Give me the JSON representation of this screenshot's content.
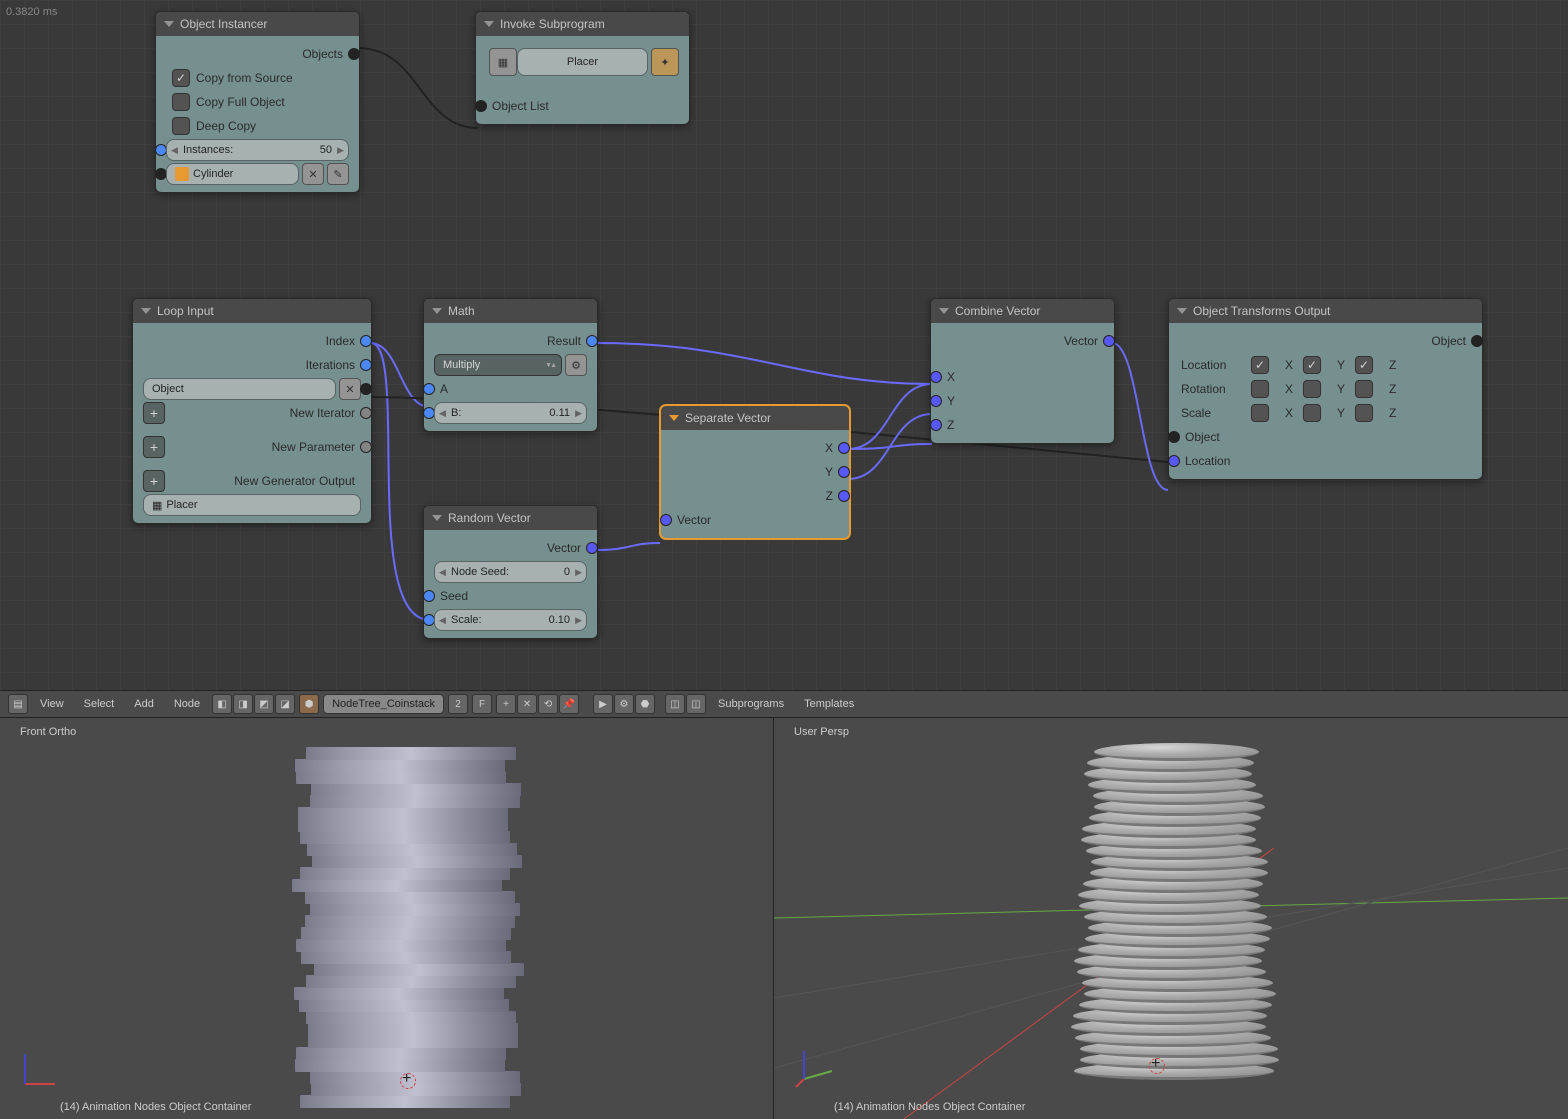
{
  "timing": "0.3820 ms",
  "nodes": {
    "instancer": {
      "title": "Object Instancer",
      "out_objects": "Objects",
      "copy_source": "Copy from Source",
      "copy_full": "Copy Full Object",
      "deep_copy": "Deep Copy",
      "instances_label": "Instances:",
      "instances_value": "50",
      "object_value": "Cylinder"
    },
    "invoke": {
      "title": "Invoke Subprogram",
      "program": "Placer",
      "in_list": "Object List"
    },
    "loop": {
      "title": "Loop Input",
      "index": "Index",
      "iterations": "Iterations",
      "object": "Object",
      "new_iter": "New Iterator",
      "new_param": "New Parameter",
      "new_gen": "New Generator Output",
      "name": "Placer"
    },
    "math": {
      "title": "Math",
      "result": "Result",
      "op": "Multiply",
      "a": "A",
      "b_label": "B:",
      "b_value": "0.11"
    },
    "randvec": {
      "title": "Random Vector",
      "vector": "Vector",
      "seed_label": "Node Seed:",
      "seed_value": "0",
      "seed": "Seed",
      "scale_label": "Scale:",
      "scale_value": "0.10"
    },
    "sepvec": {
      "title": "Separate Vector",
      "x": "X",
      "y": "Y",
      "z": "Z",
      "vector": "Vector"
    },
    "combvec": {
      "title": "Combine Vector",
      "vector": "Vector",
      "x": "X",
      "y": "Y",
      "z": "Z"
    },
    "xform": {
      "title": "Object Transforms Output",
      "object_out": "Object",
      "location": "Location",
      "rotation": "Rotation",
      "scale": "Scale",
      "x": "X",
      "y": "Y",
      "z": "Z",
      "object_in": "Object",
      "location_in": "Location"
    }
  },
  "toolbar": {
    "view": "View",
    "select": "Select",
    "add": "Add",
    "node": "Node",
    "tree": "NodeTree_Coinstack",
    "users": "2",
    "fake": "F",
    "subprograms": "Subprograms",
    "templates": "Templates"
  },
  "viewports": {
    "left_label": "Front Ortho",
    "right_label": "User Persp",
    "status": "(14) Animation Nodes Object Container"
  }
}
